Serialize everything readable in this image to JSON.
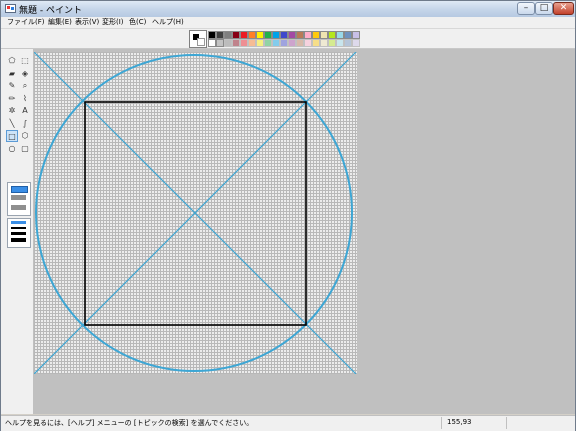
{
  "window": {
    "title": "無題 - ペイント",
    "minimize_label": "–",
    "maximize_label": "□",
    "close_label": "✕"
  },
  "menu": [
    {
      "label": "ファイル(F)"
    },
    {
      "label": "編集(E)"
    },
    {
      "label": "表示(V)"
    },
    {
      "label": "変形(I)"
    },
    {
      "label": "色(C)"
    },
    {
      "label": "ヘルプ(H)"
    }
  ],
  "colors": {
    "foreground": "#000000",
    "background": "#ffffff",
    "palette_top": [
      "#000000",
      "#808080",
      "#800000",
      "#808000",
      "#008000",
      "#008080",
      "#000080",
      "#800080",
      "#808040",
      "#004040",
      "#0080ff",
      "#004080",
      "#8000ff",
      "#804000"
    ],
    "palette_bottom": [
      "#ffffff",
      "#c0c0c0",
      "#ff0000",
      "#ffff00",
      "#00ff00",
      "#00ffff",
      "#0000ff",
      "#ff00ff",
      "#ffff80",
      "#00ff80",
      "#80ffff",
      "#8080ff",
      "#ff0080",
      "#ff8040"
    ]
  },
  "palette_display": {
    "row1": [
      "#000000",
      "#404040",
      "#7f7f7f",
      "#880015",
      "#ed1c24",
      "#ff7f27",
      "#fff200",
      "#22b14c",
      "#00a2e8",
      "#3f48cc",
      "#a349a4",
      "#b97a57",
      "#ffaec9",
      "#ffc90e",
      "#efe4b0",
      "#b5e61d",
      "#99d9ea",
      "#7092be",
      "#c8bfe7"
    ],
    "row2": [
      "#ffffff",
      "#c3c3c3"
    ]
  },
  "tools": [
    {
      "name": "free-select-icon",
      "glyph": "⬠"
    },
    {
      "name": "rect-select-icon",
      "glyph": "⬚"
    },
    {
      "name": "eraser-icon",
      "glyph": "▰"
    },
    {
      "name": "fill-icon",
      "glyph": "◈"
    },
    {
      "name": "color-picker-icon",
      "glyph": "✎"
    },
    {
      "name": "magnifier-icon",
      "glyph": "⌕"
    },
    {
      "name": "pencil-icon",
      "glyph": "✏"
    },
    {
      "name": "brush-icon",
      "glyph": "⌇"
    },
    {
      "name": "airbrush-icon",
      "glyph": "✲"
    },
    {
      "name": "text-icon",
      "glyph": "A"
    },
    {
      "name": "line-icon",
      "glyph": "╲"
    },
    {
      "name": "curve-icon",
      "glyph": "∫"
    },
    {
      "name": "rectangle-icon",
      "glyph": "□"
    },
    {
      "name": "polygon-icon",
      "glyph": "⬡"
    },
    {
      "name": "ellipse-icon",
      "glyph": "○"
    },
    {
      "name": "rounded-rect-icon",
      "glyph": "▢"
    }
  ],
  "status": {
    "help_text": "ヘルプを見るには、[ヘルプ] メニューの [トピックの検索] を選んでください。",
    "coordinates": "155,93"
  }
}
